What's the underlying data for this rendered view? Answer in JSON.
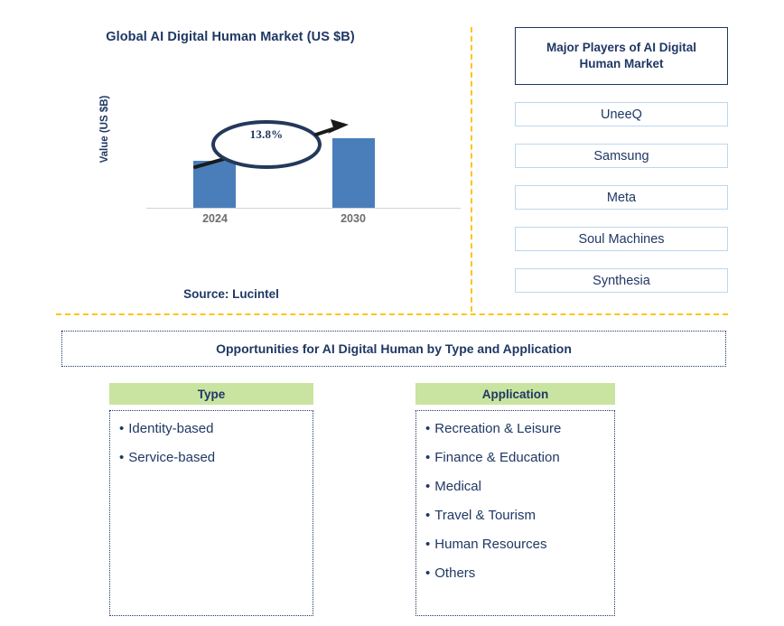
{
  "chart_panel": {
    "title": "Global AI Digital Human Market (US $B)",
    "source": "Source: Lucintel"
  },
  "chart_data": {
    "type": "bar",
    "title": "Global AI Digital Human Market (US $B)",
    "xlabel": "",
    "ylabel": "Value (US $B)",
    "categories": [
      "2024",
      "2030"
    ],
    "values": [
      52,
      77
    ],
    "value_units": "relative bar height (px); absolute values not labeled",
    "annotations": [
      {
        "text": "13.8%",
        "type": "cagr-callout",
        "from": "2024",
        "to": "2030"
      }
    ],
    "grid": false,
    "legend": false,
    "bar_color": "#4a7ebb",
    "axis_label_color": "#6d6d6d"
  },
  "players": {
    "header": "Major Players of AI Digital Human Market",
    "items": [
      "UneeQ",
      "Samsung",
      "Meta",
      "Soul Machines",
      "Synthesia"
    ]
  },
  "opportunities": {
    "banner": "Opportunities for AI Digital Human by Type and Application",
    "type": {
      "header": "Type",
      "items": [
        "Identity-based",
        "Service-based"
      ]
    },
    "application": {
      "header": "Application",
      "items": [
        "Recreation & Leisure",
        "Finance & Education",
        "Medical",
        "Travel & Tourism",
        "Human Resources",
        "Others"
      ]
    }
  },
  "colors": {
    "navy": "#1f3864",
    "bar_blue": "#4a7ebb",
    "divider_gold": "#ffc314",
    "header_green": "#c9e4a0",
    "player_border": "#bdd7ee"
  },
  "bullet_glyph": "•"
}
